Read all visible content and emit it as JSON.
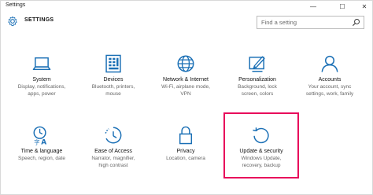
{
  "window": {
    "title": "Settings",
    "controls": {
      "minimize": "—",
      "maximize": "☐",
      "close": "✕"
    }
  },
  "header": {
    "title": "SETTINGS",
    "search_placeholder": "Find a setting"
  },
  "tiles": [
    {
      "name": "System",
      "desc1": "Display, notifications,",
      "desc2": "apps, power",
      "desc3": "",
      "icon": "laptop-icon"
    },
    {
      "name": "Devices",
      "desc1": "Bluetooth, printers,",
      "desc2": "mouse",
      "desc3": "",
      "icon": "keyboard-icon"
    },
    {
      "name": "Network & Internet",
      "desc1": "Wi-Fi, airplane mode,",
      "desc2": "VPN",
      "desc3": "",
      "icon": "globe-icon"
    },
    {
      "name": "Personalization",
      "desc1": "Background, lock",
      "desc2": "screen, colors",
      "desc3": "",
      "icon": "paintbrush-icon"
    },
    {
      "name": "Accounts",
      "desc1": "Your account, sync",
      "desc2": "settings, work, family",
      "desc3": "",
      "icon": "person-icon"
    },
    {
      "name": "Time & language",
      "desc1": "Speech, region, date",
      "desc2": "",
      "desc3": "",
      "icon": "time-language-icon"
    },
    {
      "name": "Ease of Access",
      "desc1": "Narrator, magnifier,",
      "desc2": "high contrast",
      "desc3": "",
      "icon": "ease-of-access-icon"
    },
    {
      "name": "Privacy",
      "desc1": "Location, camera",
      "desc2": "",
      "desc3": "",
      "icon": "lock-icon"
    },
    {
      "name": "Update & security",
      "desc1": "Windows Update,",
      "desc2": "recovery, backup",
      "desc3": "",
      "icon": "update-icon"
    }
  ],
  "colors": {
    "accent": "#1a6fb5",
    "highlight": "#e8005a"
  }
}
